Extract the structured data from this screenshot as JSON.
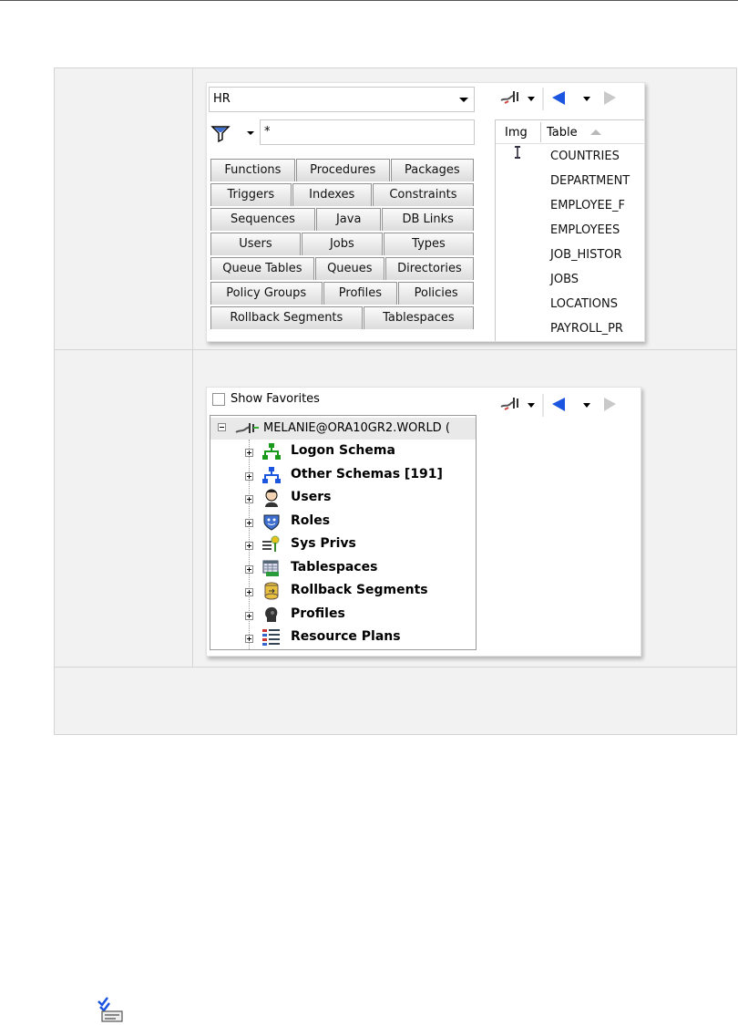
{
  "schema_browser": {
    "schema_value": "HR",
    "filter_value": "*",
    "tab_rows": [
      [
        "Functions",
        "Procedures",
        "Packages"
      ],
      [
        "Triggers",
        "Indexes",
        "Constraints"
      ],
      [
        "Sequences",
        "Java",
        "DB Links"
      ],
      [
        "Users",
        "Jobs",
        "Types"
      ],
      [
        "Queue Tables",
        "Queues",
        "Directories"
      ],
      [
        "Policy Groups",
        "Profiles",
        "Policies"
      ],
      [
        "Rollback Segments",
        "Tablespaces"
      ]
    ],
    "columns": {
      "img": "Img",
      "table": "Table"
    },
    "tables": [
      "COUNTRIES",
      "DEPARTMENT",
      "EMPLOYEE_F",
      "EMPLOYEES",
      "JOB_HISTOR",
      "JOBS",
      "LOCATIONS",
      "PAYROLL_PR"
    ]
  },
  "tree_view": {
    "show_favorites_label": "Show Favorites",
    "root_label": "MELANIE@ORA10GR2.WORLD (",
    "items": [
      {
        "label": "Logon Schema",
        "icon": "schema-icon"
      },
      {
        "label": "Other Schemas [191]",
        "icon": "schema-icon"
      },
      {
        "label": "Users",
        "icon": "user-icon"
      },
      {
        "label": "Roles",
        "icon": "role-icon"
      },
      {
        "label": "Sys Privs",
        "icon": "key-icon"
      },
      {
        "label": "Tablespaces",
        "icon": "tablespace-icon"
      },
      {
        "label": "Rollback Segments",
        "icon": "rollback-icon"
      },
      {
        "label": "Profiles",
        "icon": "profile-icon"
      },
      {
        "label": "Resource Plans",
        "icon": "plan-icon"
      }
    ]
  }
}
